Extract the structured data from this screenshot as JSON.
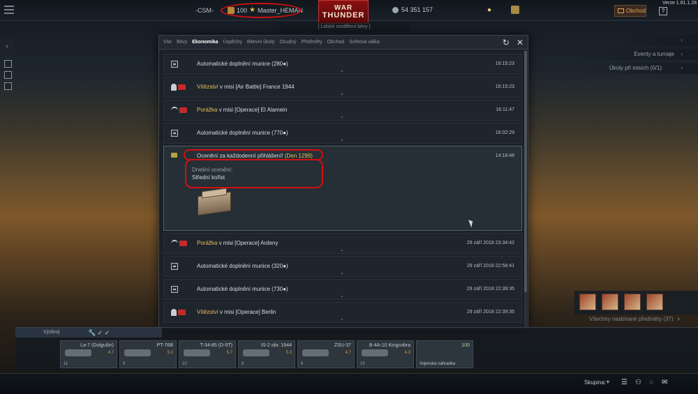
{
  "top_bar": {
    "squad": "-CSM-",
    "rank": "100",
    "player": "Master_HEMAN",
    "logo_line1": "WAR",
    "logo_line2": "THUNDER",
    "silver_lions": "54 351 157",
    "shop": "Obchod",
    "help": "?",
    "version": "Verze 1.81.1.28"
  },
  "sub_bar": "[ Lidské rozdělení bitvy ]",
  "right_panels": {
    "events": "Eventy a turnaje",
    "tasks": "Úkoly při misích",
    "tasks_count": "(0/1)",
    "trophies": "Všechny nasbírané předměty (37)"
  },
  "modal": {
    "tabs": [
      "Vše",
      "Bitvy",
      "Ekonomika",
      "Úspěchy",
      "Bitevní úkoly",
      "Osudný",
      "Předměty",
      "Obchod",
      "Světová válka"
    ],
    "active_tab": "Ekonomika",
    "rows": [
      {
        "icon": "munition",
        "prefix": "Automatické doplnění munice (280",
        "highlight": "",
        "suffix": ")",
        "time": "16:15:23"
      },
      {
        "icon": "trophy",
        "prefix": "",
        "highlight": "Vítězství",
        "suffix": " v misi [Air Battle] France 1944",
        "time": "16:15:23"
      },
      {
        "icon": "parachute",
        "prefix": "",
        "highlight": "Porážka",
        "suffix": " v misi [Operace] El Alamein",
        "time": "16:11:47"
      },
      {
        "icon": "munition",
        "prefix": "Automatické doplnění munice (770",
        "highlight": "",
        "suffix": ")",
        "time": "16:02:29"
      },
      {
        "icon": "coin",
        "prefix": "Ocenění za každodenní přihlášení! ",
        "highlight": "(Den 1299)",
        "suffix": "",
        "time": "14:18:48",
        "sub1": "Dnešní ocenění:",
        "sub2": "Střední kořist"
      },
      {
        "icon": "parachute",
        "prefix": "",
        "highlight": "Porážka",
        "suffix": " v misi [Operace] Ardeny",
        "time": "29 září 2018 23:34:42"
      },
      {
        "icon": "munition",
        "prefix": "Automatické doplnění munice (320",
        "highlight": "",
        "suffix": ")",
        "time": "29 září 2018 22:58:41"
      },
      {
        "icon": "munition",
        "prefix": "Automatické doplnění munice (730",
        "highlight": "",
        "suffix": ")",
        "time": "29 září 2018 22:39:35"
      },
      {
        "icon": "trophy",
        "prefix": "",
        "highlight": "Vítězství",
        "suffix": " v misi [Operace] Berlin",
        "time": "29 září 2018 22:39:35"
      }
    ]
  },
  "vehicles": {
    "header": "Výzbroj",
    "slots": [
      {
        "name": "La-7 (Dolgušin)",
        "br": "4.7",
        "foot": "11"
      },
      {
        "name": "PT-76B",
        "br": "5.3",
        "foot": "9"
      },
      {
        "name": "T-34-85 (D-5T)",
        "br": "5.7",
        "foot": "10"
      },
      {
        "name": "IS-2 obr. 1944",
        "br": "5.3",
        "foot": "8"
      },
      {
        "name": "ZSU-37",
        "br": "4.7",
        "foot": "6"
      },
      {
        "name": "B-4A-10 Kingcobra",
        "br": "4.3",
        "foot": "15"
      },
      {
        "name": "100",
        "br": "",
        "foot": "Vojenská náhradka"
      }
    ]
  },
  "bottom": {
    "group": "Skupina:"
  }
}
